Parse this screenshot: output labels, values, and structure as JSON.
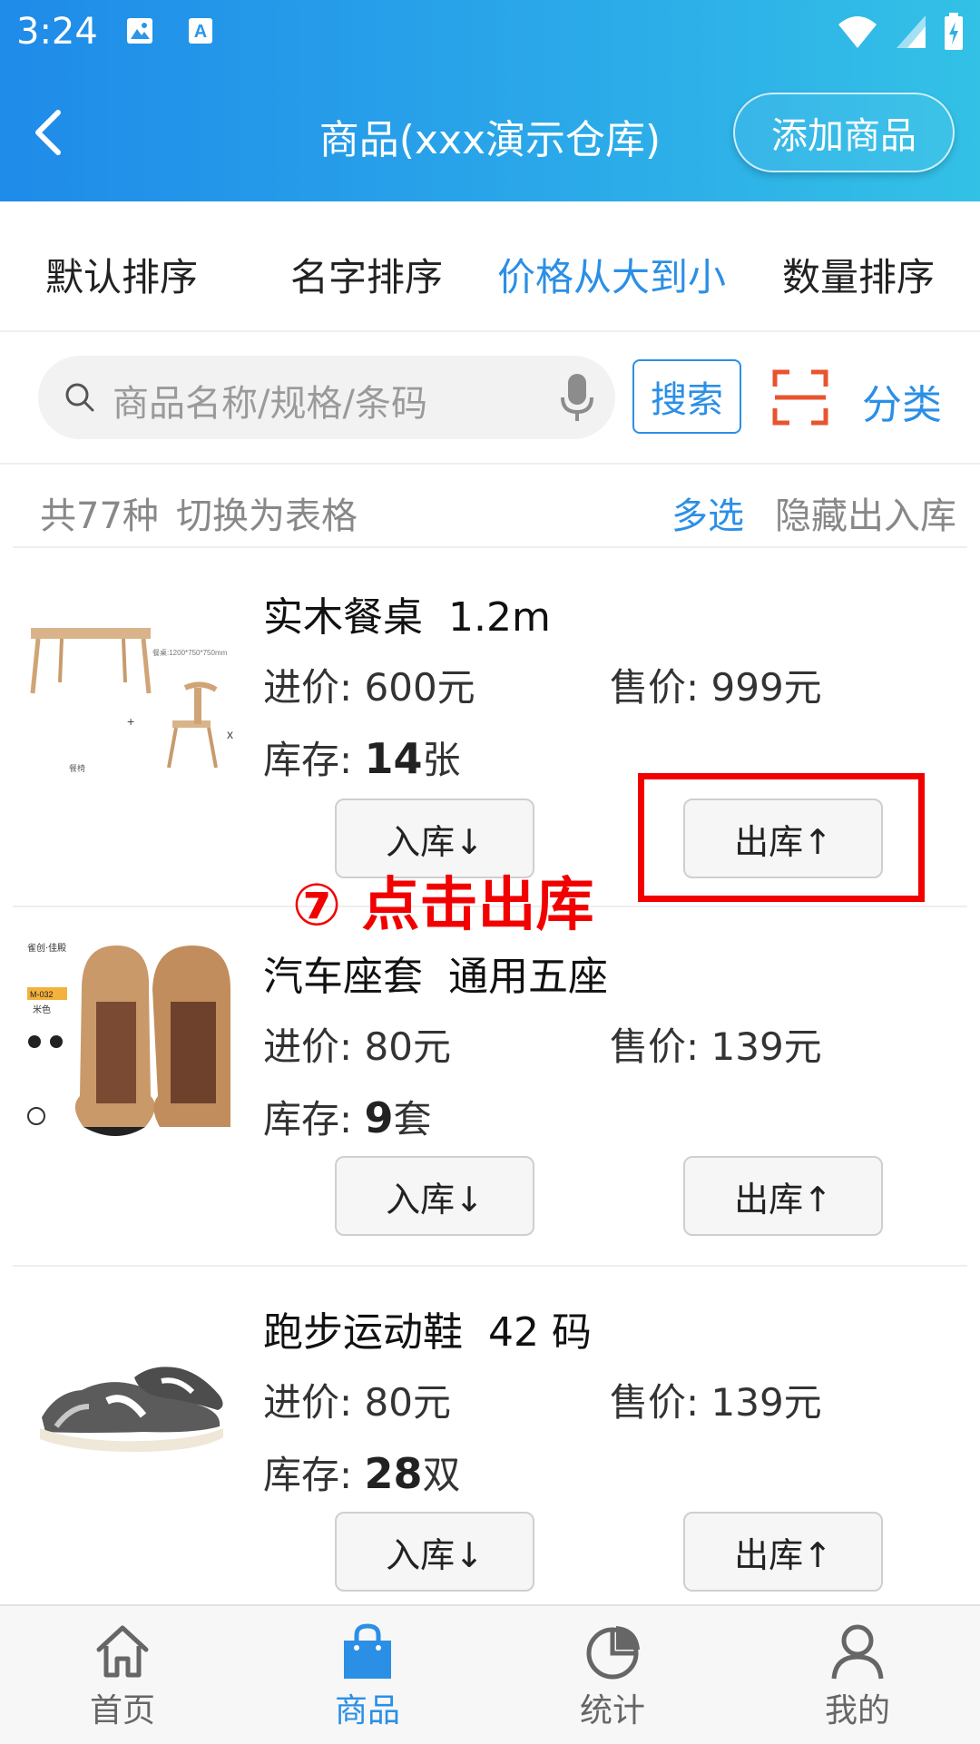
{
  "status_bar": {
    "time": "3:24"
  },
  "header": {
    "title": "商品(xxx演示仓库)",
    "add_button": "添加商品"
  },
  "sort_options": [
    "默认排序",
    "名字排序",
    "价格从大到小",
    "数量排序"
  ],
  "active_sort": "价格从大到小",
  "search": {
    "placeholder": "商品名称/规格/条码",
    "search_button": "搜索",
    "category_link": "分类"
  },
  "info_bar": {
    "count_text": "共77种",
    "switch_table": "切换为表格",
    "multi_select": "多选",
    "hide_io": "隐藏出入库"
  },
  "products": [
    {
      "name": "实木餐桌  1.2m",
      "cost_label": "进价:",
      "cost": "600元",
      "price_label": "售价:",
      "price": "999元",
      "stock_label": "库存:",
      "stock_qty": "14",
      "stock_unit": "张",
      "in_button": "入库↓",
      "out_button": "出库↑",
      "image_caption": "餐桌:1200*750*750mm",
      "image_caption2": "餐椅"
    },
    {
      "name": "汽车座套  通用五座",
      "cost_label": "进价:",
      "cost": "80元",
      "price_label": "售价:",
      "price": "139元",
      "stock_label": "库存:",
      "stock_qty": "9",
      "stock_unit": "套",
      "in_button": "入库↓",
      "out_button": "出库↑",
      "image_caption": "M-032",
      "image_caption2": "米色"
    },
    {
      "name": "跑步运动鞋  42 码",
      "cost_label": "进价:",
      "cost": "80元",
      "price_label": "售价:",
      "price": "139元",
      "stock_label": "库存:",
      "stock_qty": "28",
      "stock_unit": "双",
      "in_button": "入库↓",
      "out_button": "出库↑"
    }
  ],
  "annotation": {
    "text": "⑦ 点击出库",
    "color": "#f20000"
  },
  "tab_bar": [
    {
      "label": "首页",
      "icon": "home-icon"
    },
    {
      "label": "商品",
      "icon": "shopping-bag-icon"
    },
    {
      "label": "统计",
      "icon": "pie-chart-icon"
    },
    {
      "label": "我的",
      "icon": "user-icon"
    }
  ],
  "active_tab": "商品",
  "colors": {
    "accent": "#2b8fe6",
    "header_start": "#1f8be9",
    "header_end": "#33c1e6",
    "annotation": "#f20000"
  }
}
